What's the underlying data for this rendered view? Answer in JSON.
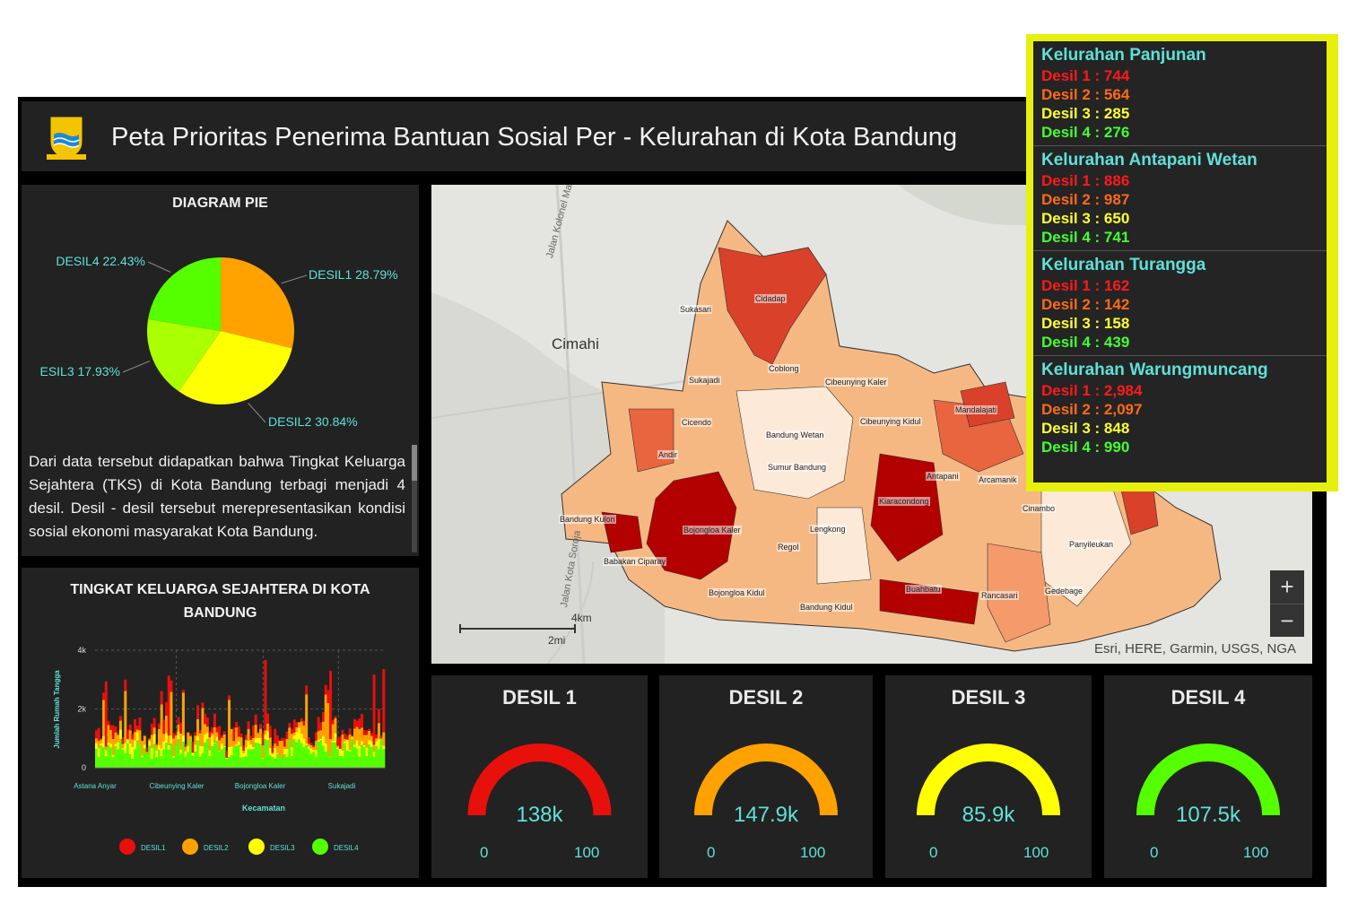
{
  "header": {
    "title": "Peta Prioritas Penerima Bantuan Sosial Per - Kelurahan di Kota Bandung"
  },
  "pie_panel": {
    "title": "DIAGRAM PIE",
    "paragraph": "Dari data tersebut didapatkan bahwa Tingkat Keluarga Sejahtera (TKS) di Kota Bandung terbagi menjadi 4 desil. Desil - desil tersebut merepresentasikan kondisi sosial ekonomi masyarakat Kota Bandung."
  },
  "tks_panel": {
    "title": "TINGKAT KELUARGA SEJAHTERA DI KOTA BANDUNG"
  },
  "map": {
    "city_label": "Cimahi",
    "road_label": "Jalan Kolonel Masturi",
    "road_label2": "Jalan Kota Soroja",
    "scale_km": "4km",
    "scale_mi": "2mi",
    "attribution": "Esri, HERE, Garmin, USGS, NGA",
    "zoom_in": "+",
    "zoom_out": "−",
    "labels": [
      "Sukasari",
      "Cidadap",
      "Sukajadi",
      "Coblong",
      "Cibeunying Kaler",
      "Cicendo",
      "Bandung Wetan",
      "Cibeunying Kidul",
      "Mandalajati",
      "Andir",
      "Sumur Bandung",
      "Antapani",
      "Arcamanik",
      "Kiaracondong",
      "Cinambo",
      "Bandung Kulon",
      "Bojongloa Kaler",
      "Regol",
      "Lengkong",
      "Panyileukan",
      "Babakan Ciparay",
      "Bojongloa Kidul",
      "Buahbatu",
      "Rancasari",
      "Gedebage",
      "Bandung Kidul"
    ]
  },
  "gauges": [
    {
      "title": "DESIL 1",
      "value": "138k",
      "min": "0",
      "max": "100",
      "color": "#e8100b"
    },
    {
      "title": "DESIL 2",
      "value": "147.9k",
      "min": "0",
      "max": "100",
      "color": "#ffa200"
    },
    {
      "title": "DESIL 3",
      "value": "85.9k",
      "min": "0",
      "max": "100",
      "color": "#ffff00"
    },
    {
      "title": "DESIL 4",
      "value": "107.5k",
      "min": "0",
      "max": "100",
      "color": "#55ff00"
    }
  ],
  "popup": {
    "kelurahan": [
      {
        "name": "Kelurahan Panjunan",
        "rows": [
          "Desil 1 : 744",
          "Desil 2 : 564",
          "Desil 3 : 285",
          "Desil 4 : 276"
        ]
      },
      {
        "name": "Kelurahan Antapani Wetan",
        "rows": [
          "Desil 1 : 886",
          "Desil 2 : 987",
          "Desil 3 : 650",
          "Desil 4 : 741"
        ]
      },
      {
        "name": "Kelurahan Turangga",
        "rows": [
          "Desil 1 : 162",
          "Desil 2 : 142",
          "Desil 3 : 158",
          "Desil 4 : 439"
        ]
      },
      {
        "name": "Kelurahan Warungmuncang",
        "rows": [
          "Desil 1 : 2,984",
          "Desil 2 : 2,097",
          "Desil 3 : 848",
          "Desil 4 : 990"
        ]
      }
    ],
    "row_colors": [
      "#ff1a1a",
      "#ff6a1a",
      "#ffff33",
      "#44ff33"
    ]
  },
  "chart_data": [
    {
      "type": "pie",
      "categories": [
        "DESIL1",
        "DESIL2",
        "DESIL3",
        "DESIL4"
      ],
      "values": [
        28.79,
        30.84,
        17.93,
        22.43
      ],
      "labels": [
        "DESIL1 28.79%",
        "DESIL2 30.84%",
        "ESIL3 17.93%",
        "DESIL4 22.43%"
      ],
      "colors": [
        "#ffa200",
        "#ffff00",
        "#aaff00",
        "#55ff00"
      ]
    },
    {
      "type": "bar",
      "stacked": true,
      "xlabel": "Kecamatan",
      "ylabel": "Jumlah Rumah Tangga",
      "ylim": [
        0,
        4000
      ],
      "yticks": [
        "0",
        "2k",
        "4k"
      ],
      "xticks": [
        "Astana Anyar",
        "Cibeunying Kaler",
        "Bojongloa Kaler",
        "Sukajadi"
      ],
      "legend": [
        "DESIL1",
        "DESIL2",
        "DESIL3",
        "DESIL4"
      ],
      "colors": [
        "#e8100b",
        "#ffa200",
        "#ffff00",
        "#55ff00"
      ],
      "grid": true
    }
  ]
}
